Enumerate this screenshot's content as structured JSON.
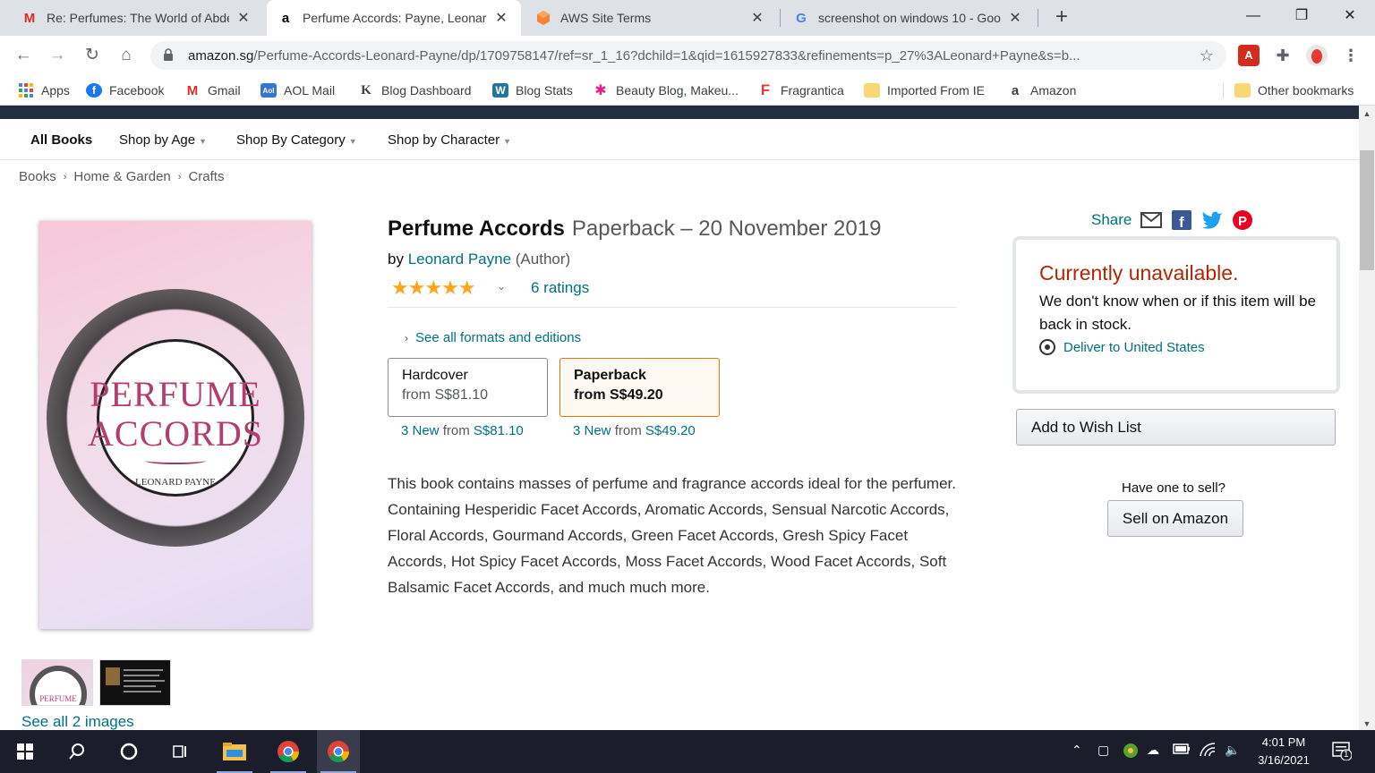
{
  "browser": {
    "tabs": [
      {
        "title": "Re: Perfumes: The World of Abdes",
        "icon": "gmail-icon"
      },
      {
        "title": "Perfume Accords: Payne, Leonard",
        "icon": "amazon-icon"
      },
      {
        "title": "AWS Site Terms",
        "icon": "aws-icon"
      },
      {
        "title": "screenshot on windows 10 - Goo",
        "icon": "google-icon"
      }
    ],
    "url_host": "amazon.sg",
    "url_path": "/Perfume-Accords-Leonard-Payne/dp/1709758147/ref=sr_1_16?dchild=1&qid=1615927833&refinements=p_27%3ALeonard+Payne&s=b...",
    "bookmarks": [
      {
        "label": "Apps"
      },
      {
        "label": "Facebook"
      },
      {
        "label": "Gmail"
      },
      {
        "label": "AOL Mail"
      },
      {
        "label": "Blog Dashboard"
      },
      {
        "label": "Blog Stats"
      },
      {
        "label": "Beauty Blog, Makeu..."
      },
      {
        "label": "Fragrantica"
      },
      {
        "label": "Imported From IE"
      },
      {
        "label": "Amazon"
      }
    ],
    "other_bookmarks": "Other bookmarks",
    "colors": {
      "tabstrip": "#dee1e6",
      "omnibox": "#f1f3f4"
    }
  },
  "subnav": {
    "items": [
      "All Books",
      "Shop by Age",
      "Shop By Category",
      "Shop by Character"
    ]
  },
  "breadcrumb": [
    "Books",
    "Home & Garden",
    "Crafts"
  ],
  "cover": {
    "title_line1": "PERFUME",
    "title_line2": "ACCORDS",
    "author": "LEONARD PAYNE",
    "thumb_text": "PERFUME"
  },
  "gallery": {
    "see_all": "See all 2 images"
  },
  "product": {
    "title": "Perfume Accords",
    "format_date": "Paperback – 20 November 2019",
    "by": "by",
    "author": "Leonard Payne",
    "author_role": "(Author)",
    "stars": "★★★★★",
    "rating_value": 5,
    "ratings": "6 ratings",
    "see_formats": "See all formats and editions",
    "formats": [
      {
        "name": "Hardcover",
        "price": "from S$81.10",
        "new_count": "3 New",
        "from": "from",
        "new_price": "S$81.10",
        "selected": false
      },
      {
        "name": "Paperback",
        "price": "from S$49.20",
        "new_count": "3 New",
        "from": "from",
        "new_price": "S$49.20",
        "selected": true
      }
    ],
    "description": "This book contains masses of perfume and fragrance accords ideal for the perfumer. Containing Hesperidic Facet Accords, Aromatic Accords, Sensual Narcotic Accords, Floral Accords, Gourmand Accords, Green Facet Accords, Gresh Spicy Facet Accords, Hot Spicy Facet Accords, Moss Facet Accords, Wood Facet Accords, Soft Balsamic Facet Accords, and much much more."
  },
  "buybox": {
    "share": "Share",
    "unavailable": "Currently unavailable.",
    "message": "We don't know when or if this item will be back in stock.",
    "deliver": "Deliver to United States",
    "wish_list": "Add to Wish List",
    "have_one": "Have one to sell?",
    "sell": "Sell on Amazon",
    "colors": {
      "unavailable": "#b12704",
      "link": "#007185",
      "stars": "#ffa41c"
    }
  },
  "taskbar": {
    "time": "4:01 PM",
    "date": "3/16/2021",
    "notifications": "1"
  }
}
